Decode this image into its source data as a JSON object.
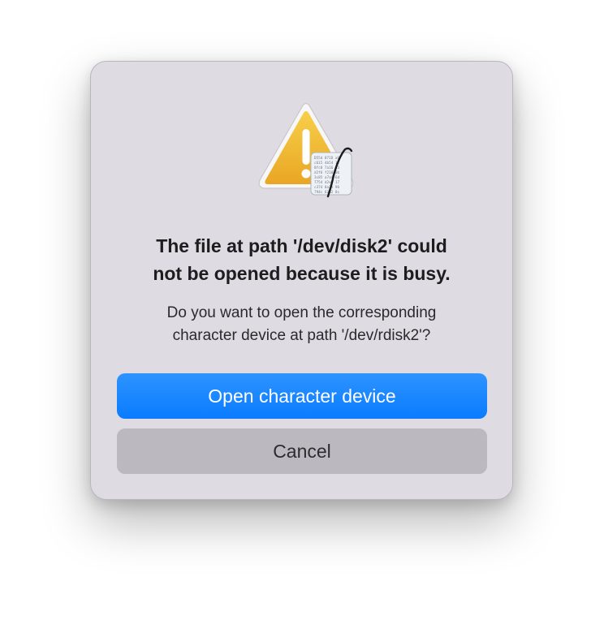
{
  "dialog": {
    "icon": "warning-triangle-icon",
    "badge_icon": "hex-editor-document-icon",
    "title": "The file at path '/dev/disk2' could\nnot be opened because it is busy.",
    "message": "Do you want to open the corresponding\ncharacter device at path '/dev/rdisk2'?",
    "primary_button": "Open character device",
    "cancel_button": "Cancel"
  },
  "colors": {
    "primary": "#0a7cff",
    "warning": "#f0b52a",
    "dialog_background": "#dedbe2",
    "cancel_background": "#bbb8bf"
  }
}
